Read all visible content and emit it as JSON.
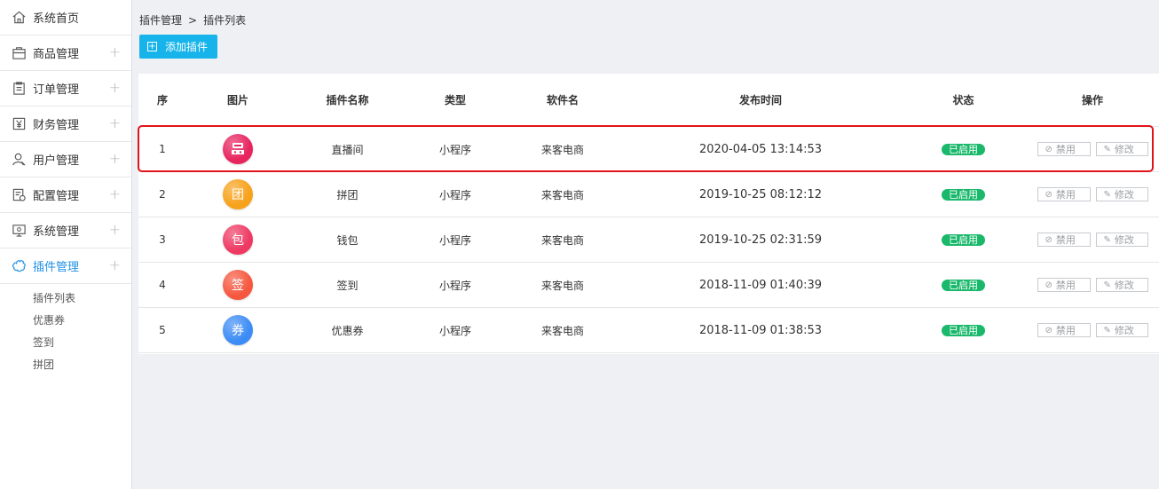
{
  "sidebar": {
    "items": [
      {
        "label": "系统首页",
        "icon": "home-icon",
        "expandable": false
      },
      {
        "label": "商品管理",
        "icon": "bag-icon",
        "expandable": true
      },
      {
        "label": "订单管理",
        "icon": "clipboard-icon",
        "expandable": true
      },
      {
        "label": "财务管理",
        "icon": "yen-icon",
        "expandable": true
      },
      {
        "label": "用户管理",
        "icon": "user-icon",
        "expandable": true
      },
      {
        "label": "配置管理",
        "icon": "config-icon",
        "expandable": true
      },
      {
        "label": "系统管理",
        "icon": "monitor-icon",
        "expandable": true
      },
      {
        "label": "插件管理",
        "icon": "puzzle-icon",
        "expandable": true,
        "active": true
      }
    ],
    "sub_items": [
      "插件列表",
      "优惠券",
      "签到",
      "拼团"
    ],
    "plus_glyph": "+"
  },
  "breadcrumb": {
    "parent": "插件管理",
    "separator": ">",
    "current": "插件列表"
  },
  "toolbar": {
    "add_label": "添加插件",
    "add_icon": "plus-square-icon",
    "add_color": "#16b4ea"
  },
  "table": {
    "headers": [
      "序",
      "图片",
      "插件名称",
      "类型",
      "软件名",
      "发布时间",
      "状态",
      "操作"
    ],
    "rows": [
      {
        "index": "1",
        "avatar_glyph": "",
        "avatar_icon": "live-icon",
        "avatar_color": "#e8245f",
        "name": "直播间",
        "type": "小程序",
        "software": "来客电商",
        "time": "2020-04-05 13:14:53",
        "status": "已启用"
      },
      {
        "index": "2",
        "avatar_glyph": "团",
        "avatar_icon": "group-icon",
        "avatar_color": "#f7a21b",
        "name": "拼团",
        "type": "小程序",
        "software": "来客电商",
        "time": "2019-10-25 08:12:12",
        "status": "已启用"
      },
      {
        "index": "3",
        "avatar_glyph": "包",
        "avatar_icon": "wallet-icon",
        "avatar_color": "#ee3a63",
        "name": "钱包",
        "type": "小程序",
        "software": "来客电商",
        "time": "2019-10-25 02:31:59",
        "status": "已启用"
      },
      {
        "index": "4",
        "avatar_glyph": "签",
        "avatar_icon": "sign-icon",
        "avatar_color": "#f5583f",
        "name": "签到",
        "type": "小程序",
        "software": "来客电商",
        "time": "2018-11-09 01:40:39",
        "status": "已启用"
      },
      {
        "index": "5",
        "avatar_glyph": "券",
        "avatar_icon": "coupon-icon",
        "avatar_color": "#3d8cf5",
        "name": "优惠券",
        "type": "小程序",
        "software": "来客电商",
        "time": "2018-11-09 01:38:53",
        "status": "已启用"
      }
    ],
    "actions": {
      "disable_label": "禁用",
      "edit_label": "修改",
      "disable_icon": "ban-icon",
      "edit_icon": "edit-icon"
    },
    "status_color": "#1ab86b",
    "highlight_color": "#e0141a"
  }
}
